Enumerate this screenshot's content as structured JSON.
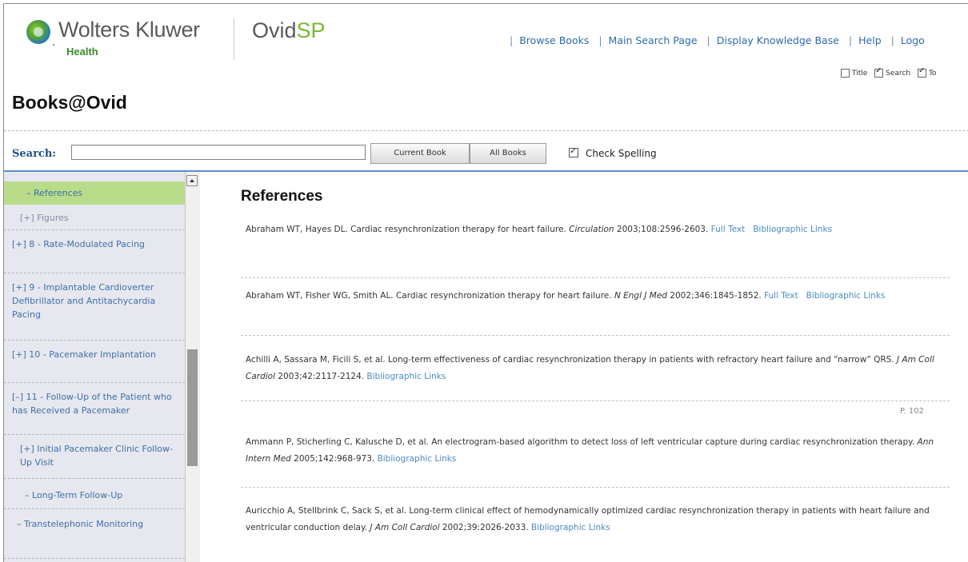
{
  "header": {
    "logo_name": "Wolters Kluwer",
    "logo_sub": "Health",
    "product_prefix": "Ovid",
    "product_suffix": "SP",
    "nav": [
      "Browse Books",
      "Main Search Page",
      "Display Knowledge Base",
      "Help",
      "Logo"
    ],
    "options": [
      {
        "label": "Title",
        "checked": false
      },
      {
        "label": "Search",
        "checked": true
      },
      {
        "label": "To",
        "checked": true
      }
    ]
  },
  "brand_title": "Books@Ovid",
  "search": {
    "label": "Search:",
    "value": "",
    "current_book": "Current Book",
    "all_books": "All Books",
    "check_spelling": "Check Spelling"
  },
  "sidebar": {
    "items": [
      {
        "label": "–  References"
      },
      {
        "label": "[+] Figures"
      },
      {
        "label": "[+] 8 - Rate-Modulated Pacing"
      },
      {
        "label": "[+] 9 - Implantable Cardioverter Defibrillator and Antitachycardia Pacing"
      },
      {
        "label": "[+] 10 - Pacemaker Implantation"
      },
      {
        "label": "[–] 11 - Follow-Up of the Patient who has Received a Pacemaker"
      },
      {
        "label": "[+] Initial Pacemaker Clinic Follow-Up Visit"
      },
      {
        "label": "–  Long-Term Follow-Up"
      },
      {
        "label": "–  Transtelephonic Monitoring"
      }
    ]
  },
  "main": {
    "title": "References",
    "page_number": "P. 102",
    "references": [
      {
        "text": "Abraham WT, Hayes DL. Cardiac resynchronization therapy for heart failure. ",
        "journal": "Circulation",
        "citation": " 2003;108:2596-2603. ",
        "links": [
          "Full Text",
          "Bibliographic Links"
        ]
      },
      {
        "text": "Abraham WT, Fisher WG, Smith AL. Cardiac resynchronization therapy for heart failure. ",
        "journal": "N Engl J Med",
        "citation": " 2002;346:1845-1852. ",
        "links": [
          "Full Text",
          "Bibliographic Links"
        ]
      },
      {
        "text": "Achilli A, Sassara M, Ficili S, et al. Long-term effectiveness of cardiac resynchronization therapy in patients with refractory heart failure and “narrow” QRS. ",
        "journal": "J Am Coll Cardiol",
        "citation": " 2003;42:2117-2124. ",
        "links": [
          "Bibliographic Links"
        ]
      },
      {
        "text": "Ammann P, Sticherling C, Kalusche D, et al. An electrogram-based algorithm to detect loss of left ventricular capture during cardiac resynchronization therapy. ",
        "journal": "Ann Intern Med",
        "citation": " 2005;142:968-973. ",
        "links": [
          "Bibliographic Links"
        ]
      },
      {
        "text": "Auricchio A, Stellbrink C, Sack S, et al. Long-term clinical effect of hemodynamically optimized cardiac resynchronization therapy in patients with heart failure and ventricular conduction delay. ",
        "journal": "J Am Coll Cardiol",
        "citation": " 2002;39:2026-2033. ",
        "links": [
          "Bibliographic Links"
        ]
      }
    ]
  }
}
